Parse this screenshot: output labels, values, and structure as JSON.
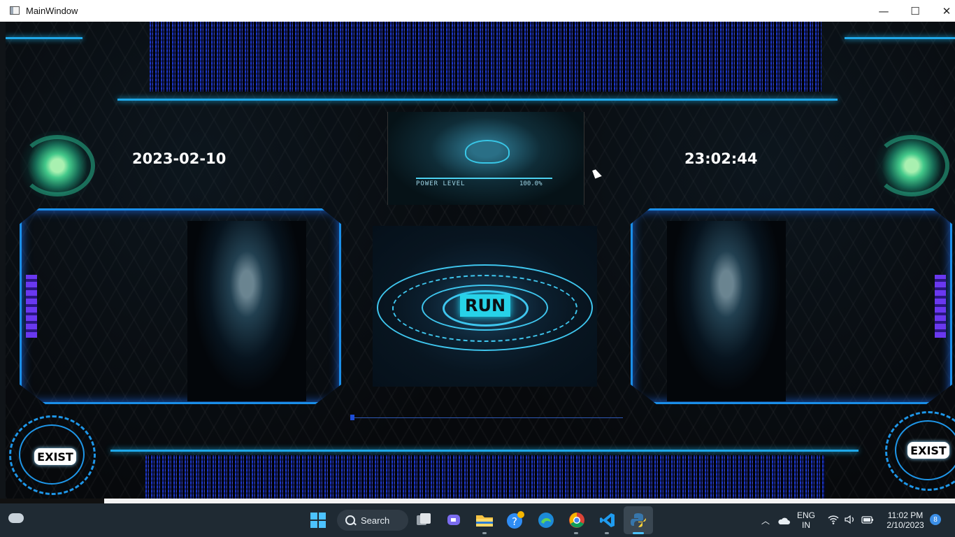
{
  "window": {
    "title": "MainWindow",
    "min_glyph": "—",
    "max_glyph": "☐",
    "close_glyph": "✕"
  },
  "app": {
    "date": "2023-02-10",
    "time": "23:02:44",
    "run_label": "RUN",
    "exist_left_label": "EXIST",
    "exist_right_label": "EXIST",
    "power_level_label": "POWER LEVEL",
    "power_level_value": "100.0%",
    "progress_fraction": 0.015
  },
  "taskbar": {
    "search_label": "Search",
    "language": "ENG",
    "region": "IN",
    "clock_time": "11:02 PM",
    "clock_date": "2/10/2023",
    "notification_count": "8",
    "icons": [
      "start-icon",
      "search-icon",
      "task-view-icon",
      "chat-icon",
      "file-explorer-icon",
      "tips-icon",
      "edge-icon",
      "chrome-icon",
      "vscode-icon",
      "python-icon"
    ]
  },
  "colors": {
    "accent": "#1ea7e8",
    "run_button": "#27d2e8",
    "panel_border": "#1a8ee8",
    "taskbar_bg": "#1f2a33"
  }
}
